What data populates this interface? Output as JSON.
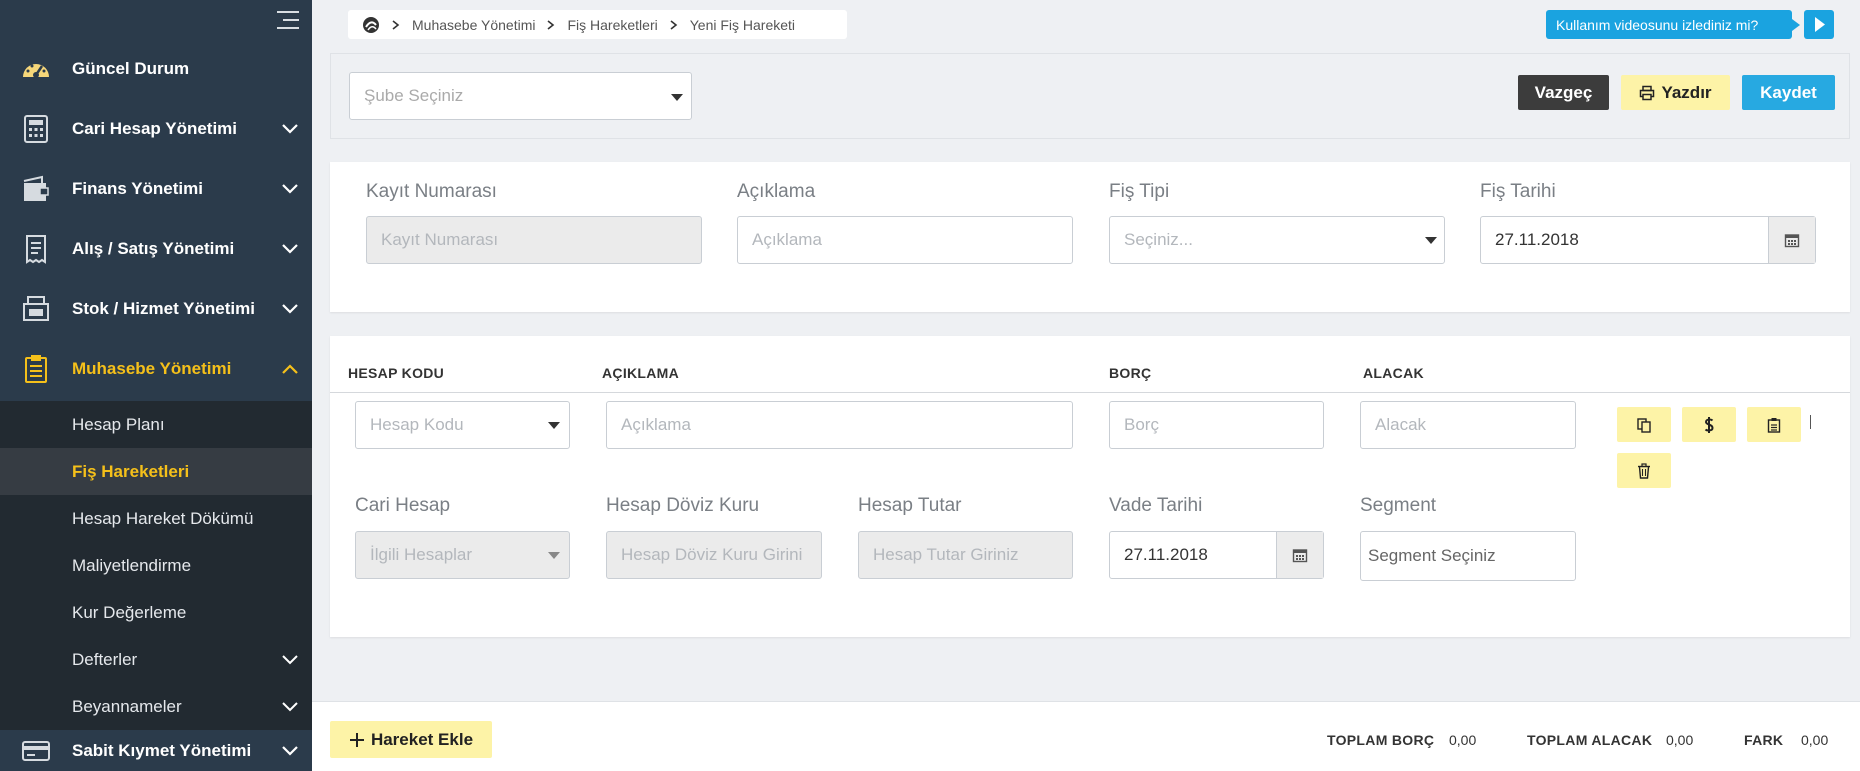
{
  "sidebar": {
    "items": [
      {
        "label": "Güncel Durum",
        "icon": "dashboard-icon"
      },
      {
        "label": "Cari Hesap Yönetimi",
        "icon": "calculator-icon"
      },
      {
        "label": "Finans Yönetimi",
        "icon": "wallet-icon"
      },
      {
        "label": "Alış / Satış Yönetimi",
        "icon": "receipt-icon"
      },
      {
        "label": "Stok / Hizmet Yönetimi",
        "icon": "box-icon"
      },
      {
        "label": "Muhasebe Yönetimi",
        "icon": "clipboard-icon"
      },
      {
        "label": "Sabit Kıymet Yönetimi",
        "icon": "card-icon"
      }
    ],
    "sub_items": [
      {
        "label": "Hesap Planı"
      },
      {
        "label": "Fiş Hareketleri"
      },
      {
        "label": "Hesap Hareket Dökümü"
      },
      {
        "label": "Maliyetlendirme"
      },
      {
        "label": "Kur Değerleme"
      },
      {
        "label": "Defterler"
      },
      {
        "label": "Beyannameler"
      }
    ],
    "active_item": "Muhasebe Yönetimi",
    "active_sub_item": "Fiş Hareketleri"
  },
  "breadcrumb": [
    "Muhasebe Yönetimi",
    "Fiş Hareketleri",
    "Yeni Fiş Hareketi"
  ],
  "video": {
    "label": "Kullanım videosunu izlediniz mi?"
  },
  "toolbar": {
    "branch_placeholder": "Şube Seçiniz",
    "cancel_label": "Vazgeç",
    "print_label": "Yazdır",
    "save_label": "Kaydet"
  },
  "header_form": {
    "record_no": {
      "label": "Kayıt Numarası",
      "placeholder": "Kayıt Numarası"
    },
    "description": {
      "label": "Açıklama",
      "placeholder": "Açıklama"
    },
    "slip_type": {
      "label": "Fiş Tipi",
      "placeholder": "Seçiniz..."
    },
    "slip_date": {
      "label": "Fiş Tarihi",
      "value": "27.11.2018"
    }
  },
  "lines": {
    "columns": [
      "HESAP KODU",
      "AÇIKLAMA",
      "BORÇ",
      "ALACAK"
    ],
    "row": {
      "account_code_placeholder": "Hesap Kodu",
      "description_placeholder": "Açıklama",
      "debit_placeholder": "Borç",
      "credit_placeholder": "Alacak",
      "current_account": {
        "label": "Cari Hesap",
        "placeholder": "İlgili Hesaplar"
      },
      "fx_rate": {
        "label": "Hesap Döviz Kuru",
        "placeholder": "Hesap Döviz Kuru Girini"
      },
      "amount": {
        "label": "Hesap Tutar",
        "placeholder": "Hesap Tutar Giriniz"
      },
      "due_date": {
        "label": "Vade Tarihi",
        "value": "27.11.2018"
      },
      "segment": {
        "label": "Segment",
        "placeholder": "Segment Seçiniz"
      }
    }
  },
  "footer": {
    "add_line_label": "Hareket Ekle",
    "total_debit_label": "TOPLAM BORÇ",
    "total_debit": "0,00",
    "total_credit_label": "TOPLAM ALACAK",
    "total_credit": "0,00",
    "diff_label": "FARK",
    "diff": "0,00"
  },
  "colors": {
    "sidebar": "#2b3b4b",
    "submenu": "#222a31",
    "accent_yellow": "#f5c01a",
    "primary_blue": "#27a9e1",
    "button_yellow": "#fdf3a7"
  }
}
